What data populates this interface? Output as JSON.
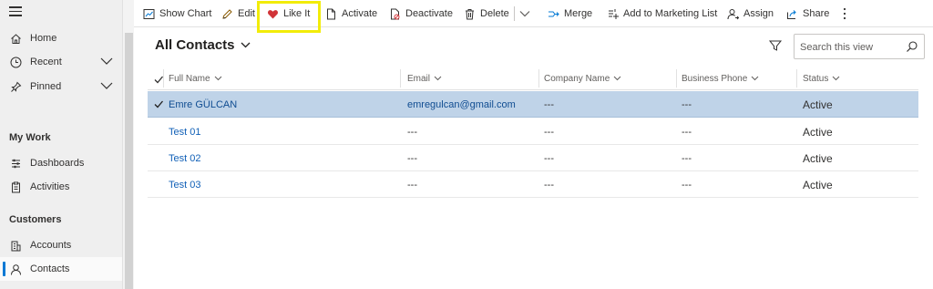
{
  "sidebar": {
    "items_top": [
      {
        "label": "Home",
        "icon": "home-icon"
      },
      {
        "label": "Recent",
        "icon": "clock-icon"
      },
      {
        "label": "Pinned",
        "icon": "pin-icon"
      }
    ],
    "my_work_title": "My Work",
    "my_work_items": [
      {
        "label": "Dashboards",
        "icon": "dashboard-icon"
      },
      {
        "label": "Activities",
        "icon": "clipboard-icon"
      }
    ],
    "customers_title": "Customers",
    "customers_items": [
      {
        "label": "Accounts",
        "icon": "building-icon"
      },
      {
        "label": "Contacts",
        "icon": "person-icon"
      }
    ]
  },
  "commands": {
    "show_chart": "Show Chart",
    "edit": "Edit",
    "like_it": "Like It",
    "activate": "Activate",
    "deactivate": "Deactivate",
    "delete": "Delete",
    "merge": "Merge",
    "add_to_marketing_list": "Add to Marketing List",
    "assign": "Assign",
    "share": "Share"
  },
  "view": {
    "title": "All Contacts",
    "search_placeholder": "Search this view"
  },
  "columns": {
    "full_name": "Full Name",
    "email": "Email",
    "company_name": "Company Name",
    "business_phone": "Business Phone",
    "status": "Status"
  },
  "rows": [
    {
      "full_name": "Emre GÜLCAN",
      "email": "emregulcan@gmail.com",
      "company_name": "---",
      "business_phone": "---",
      "status": "Active"
    },
    {
      "full_name": "Test 01",
      "email": "---",
      "company_name": "---",
      "business_phone": "---",
      "status": "Active"
    },
    {
      "full_name": "Test 02",
      "email": "---",
      "company_name": "---",
      "business_phone": "---",
      "status": "Active"
    },
    {
      "full_name": "Test 03",
      "email": "---",
      "company_name": "---",
      "business_phone": "---",
      "status": "Active"
    }
  ],
  "colors": {
    "accent": "#0078d4",
    "link": "#1160b7",
    "selected_row": "#bfd3e8",
    "highlight": "#f2ec0a",
    "heart": "#d13438"
  }
}
